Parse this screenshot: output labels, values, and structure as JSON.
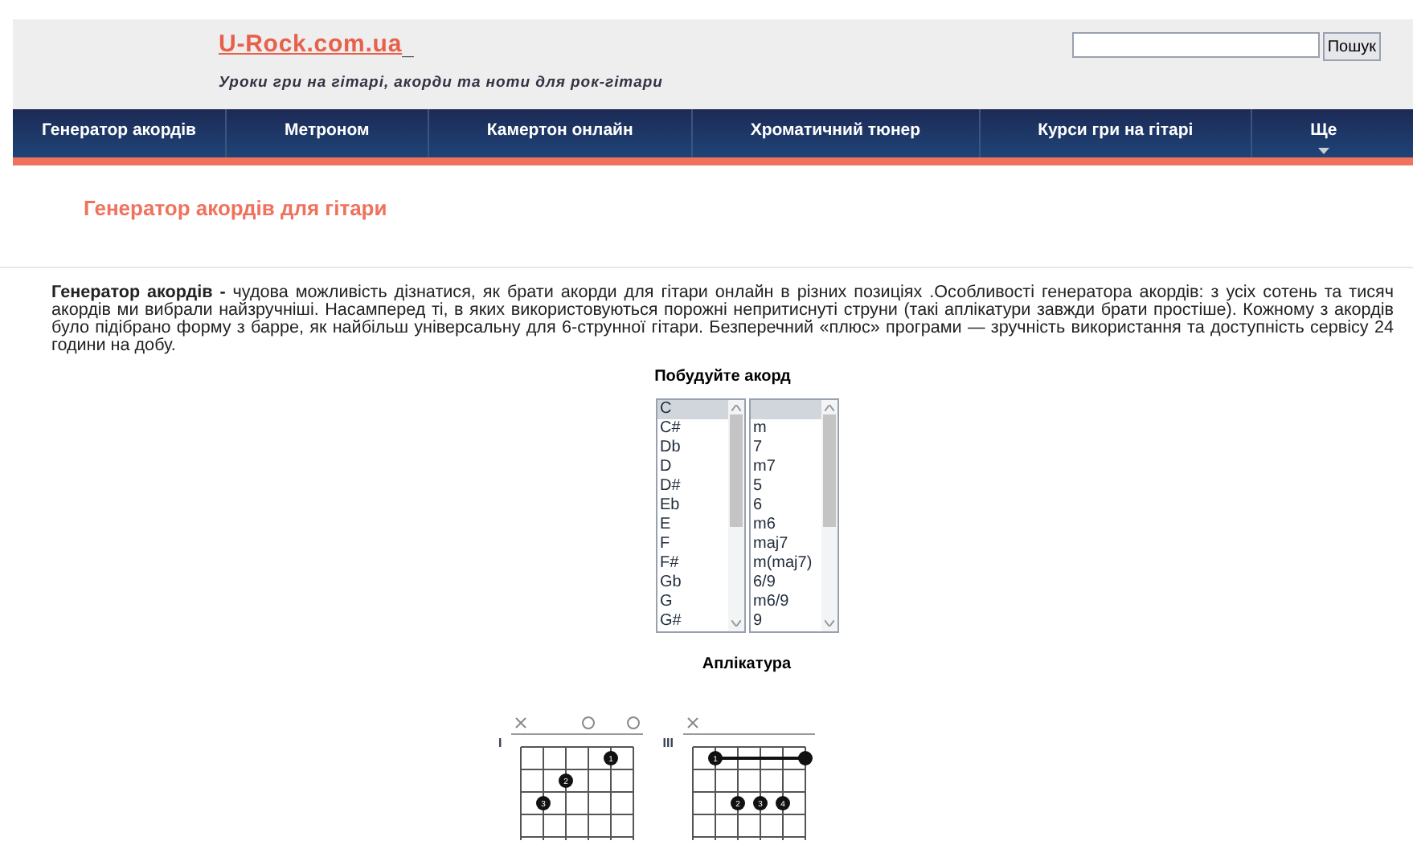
{
  "header": {
    "logo": "U-Rock.com.ua",
    "logo_suffix": "_",
    "tagline": "Уроки гри на гітарі, акорди та ноти для рок-гітари",
    "search": {
      "button": "Пошук"
    }
  },
  "nav": [
    {
      "label": "Генератор акордів",
      "dropdown": false
    },
    {
      "label": "Метроном",
      "dropdown": false
    },
    {
      "label": "Камертон онлайн",
      "dropdown": false
    },
    {
      "label": "Хроматичний тюнер",
      "dropdown": false
    },
    {
      "label": "Курси гри на гітарі",
      "dropdown": false
    },
    {
      "label": "Ще",
      "dropdown": true
    }
  ],
  "page_title": "Генератор акордів для гітари",
  "intro": "**Генератор акордів -** чудова можливість дізнатися, як брати акорди для гітари онлайн в різних позиціях .Особливості генератора акордів: з усіх сотень та тисяч акордів ми вибрали найзручніші. Насамперед ті, в яких використовуються порожні непритиснуті струни (такі аплікатури завжди брати простіше). Кожному з акордів було підібрано форму з барре, як найбільш універсальну для 6-струнної гітари. Безперечний «плюс» програми — зручність використання та доступність сервісу 24 години на добу.",
  "builder": {
    "title": "Побудуйте акорд",
    "roots": [
      {
        "label": "C",
        "selected": true
      },
      {
        "label": "C#",
        "selected": false
      },
      {
        "label": "Db",
        "selected": false
      },
      {
        "label": "D",
        "selected": false
      },
      {
        "label": "D#",
        "selected": false
      },
      {
        "label": "Eb",
        "selected": false
      },
      {
        "label": "E",
        "selected": false
      },
      {
        "label": "F",
        "selected": false
      },
      {
        "label": "F#",
        "selected": false
      },
      {
        "label": "Gb",
        "selected": false
      },
      {
        "label": "G",
        "selected": false
      },
      {
        "label": "G#",
        "selected": false
      }
    ],
    "blank_type_selected": true,
    "types": [
      {
        "label": "m",
        "selected": false
      },
      {
        "label": "7",
        "selected": false
      },
      {
        "label": "m7",
        "selected": false
      },
      {
        "label": "5",
        "selected": false
      },
      {
        "label": "6",
        "selected": false
      },
      {
        "label": "m6",
        "selected": false
      },
      {
        "label": "maj7",
        "selected": false
      },
      {
        "label": "m(maj7)",
        "selected": false
      },
      {
        "label": "6/9",
        "selected": false
      },
      {
        "label": "m6/9",
        "selected": false
      },
      {
        "label": "9",
        "selected": false
      }
    ]
  },
  "fingering_title": "Аплікатура",
  "diagrams": [
    {
      "kind": "open",
      "fret_label": "I",
      "fingers": [
        "1",
        "2",
        "3"
      ]
    },
    {
      "kind": "barre",
      "fret_label": "III",
      "fingers": [
        "1",
        "2",
        "3",
        "4"
      ]
    }
  ]
}
